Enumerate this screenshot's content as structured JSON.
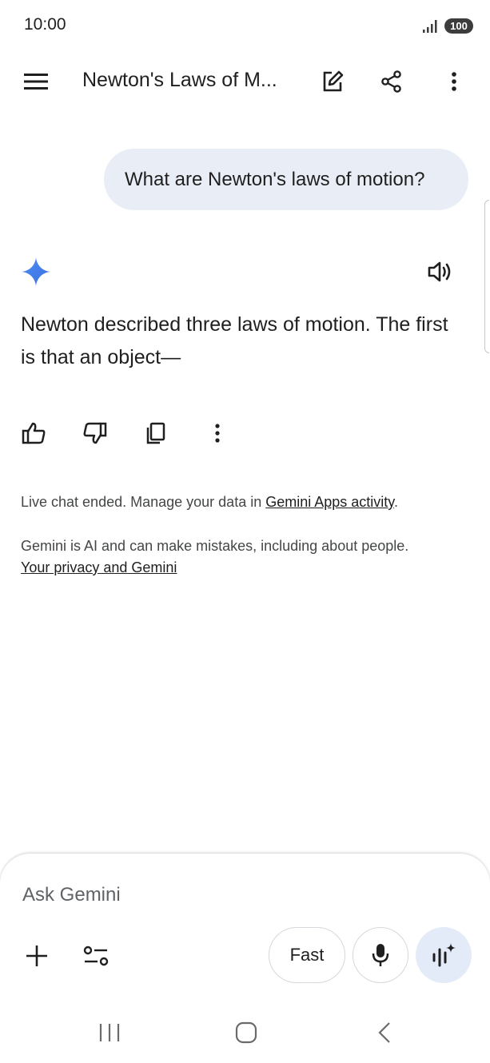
{
  "status_bar": {
    "time": "10:00",
    "battery": "100"
  },
  "top_bar": {
    "title": "Newton's Laws of M..."
  },
  "chat": {
    "user_message": "What are Newton's laws of motion?",
    "response": "Newton described three laws of motion. The first is that an object—"
  },
  "notices": {
    "live_prefix": "Live chat ended. Manage your data in ",
    "live_link": "Gemini Apps activity",
    "live_suffix": ".",
    "ai_disclaimer": "Gemini is AI and can make mistakes, including about people.",
    "privacy_link": "Your privacy and Gemini"
  },
  "composer": {
    "placeholder": "Ask Gemini",
    "mode_label": "Fast"
  },
  "icons": {
    "menu": "menu-icon",
    "edit": "edit-icon",
    "share": "share-icon",
    "more": "more-vert-icon",
    "speaker": "speaker-icon",
    "thumbs_up": "thumbs-up-icon",
    "thumbs_down": "thumbs-down-icon",
    "copy": "copy-icon",
    "add": "plus-icon",
    "tools": "tools-icon",
    "mic": "mic-icon",
    "live": "live-icon"
  },
  "colors": {
    "bubble": "#e9eef6",
    "live_button": "#e4ebf8",
    "text": "#1f1f1f"
  }
}
